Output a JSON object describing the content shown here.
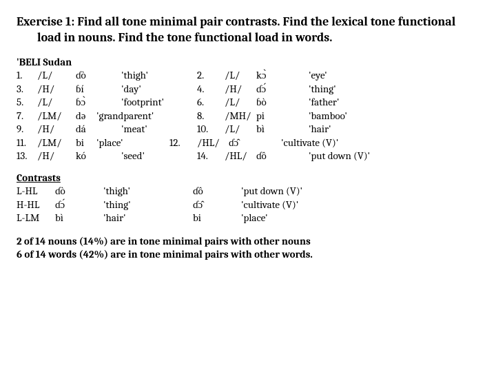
{
  "title": "Exercise 1:  Find all tone minimal pair contrasts.  Find the lexical tone functional load in nouns.  Find the tone functional load in words.",
  "lang_label": "'BELI Sudan",
  "rows": [
    {
      "n1": "1.",
      "t1": "/L/",
      "w1": "ɗò",
      "g1": "'thigh'",
      "n2": "2.",
      "t2": "/L/",
      "w2": "kɔ̀",
      "g2": "'eye'"
    },
    {
      "n1": "3.",
      "t1": "/H/",
      "w1": "ɓí",
      "g1": "'day'",
      "n2": "4.",
      "t2": "/H/",
      "w2": "ɗɔ́",
      "g2": "'thing'"
    },
    {
      "n1": "5.",
      "t1": "/L/",
      "w1": "ɓɔ̀",
      "g1": "'footprint'",
      "n2": "6.",
      "t2": "/L/",
      "w2": "ɓò",
      "g2": "'father'"
    },
    {
      "n1": "7.",
      "t1": "/LM/",
      "w1": "də",
      "g1": "'grandparent'",
      "n2": "8.",
      "t2": "/MH/",
      "w2": "pi",
      "g2": "'bamboo'"
    },
    {
      "n1": "9.",
      "t1": "/H/",
      "w1": "dá",
      "g1": "'meat'",
      "n2": "10.",
      "t2": "/L/",
      "w2": "bì",
      "g2": "'hair'"
    },
    {
      "n1": "11.",
      "t1": "/LM/",
      "w1": "bi",
      "g1": "'place'",
      "n2": "12.",
      "t2": "/HL/",
      "w2": "ɗɔ̂",
      "g2": "'cultivate (V)'"
    },
    {
      "n1": "13.",
      "t1": "/H/",
      "w1": "kó",
      "g1": "'seed'",
      "n2": "14.",
      "t2": "/HL/",
      "w2": "ɗô",
      "g2": "'put down (V)'"
    }
  ],
  "contrasts_label": "Contrasts",
  "contrasts": [
    {
      "a": "L-HL",
      "b": "ɗò",
      "c": "'thigh'",
      "d": "ɗô",
      "e": "'put down (V)'"
    },
    {
      "a": "H-HL",
      "b": "ɗɔ́",
      "c": "'thing'",
      "d": "ɗɔ̂",
      "e": "'cultivate (V)'"
    },
    {
      "a": "L-LM",
      "b": "bì",
      "c": "'hair'",
      "d": "bi",
      "e": "'place'"
    }
  ],
  "summary1": "2 of 14 nouns (14%) are in tone minimal pairs with other nouns",
  "summary2": "6 of 14 words (42%) are in tone minimal pairs with other words."
}
